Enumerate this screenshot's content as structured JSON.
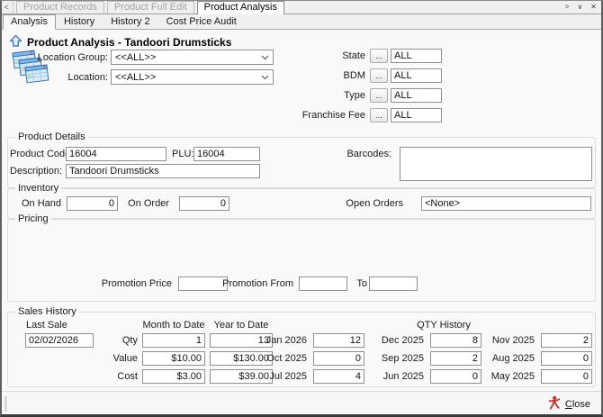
{
  "chrome": {
    "scroll_left_glyph": "<",
    "scroll_right_glyph": ">",
    "tab_list_glyph": "∨",
    "close_glyph": "✕",
    "tabs": [
      {
        "label": "Product Records"
      },
      {
        "label": "Product Full Edit"
      },
      {
        "label": "Product Analysis"
      }
    ]
  },
  "sub_tabs": [
    "Analysis",
    "History",
    "History 2",
    "Cost Price Audit"
  ],
  "page": {
    "title": "Product Analysis - Tandoori Drumsticks"
  },
  "filters": {
    "location_group_label": "Location Group:",
    "location_group_value": "<<ALL>>",
    "location_label": "Location:",
    "location_value": "<<ALL>>",
    "browse_glyph": "...",
    "rows": [
      {
        "label": "State",
        "value": "ALL"
      },
      {
        "label": "BDM",
        "value": "ALL"
      },
      {
        "label": "Type",
        "value": "ALL"
      },
      {
        "label": "Franchise Fee",
        "value": "ALL"
      }
    ]
  },
  "product_details": {
    "legend": "Product Details",
    "product_code_label": "Product Code:",
    "product_code": "16004",
    "plu_label": "PLU:",
    "plu": "16004",
    "description_label": "Description:",
    "description": "Tandoori Drumsticks",
    "barcodes_label": "Barcodes:",
    "barcodes": ""
  },
  "inventory": {
    "legend": "Inventory",
    "on_hand_label": "On Hand",
    "on_hand": "0",
    "on_order_label": "On Order",
    "on_order": "0",
    "open_orders_label": "Open Orders",
    "open_orders": "<None>"
  },
  "pricing": {
    "legend": "Pricing",
    "promotion_price_label": "Promotion Price",
    "promotion_price": "",
    "promotion_from_label": "Promotion From",
    "promotion_from": "",
    "to_label": "To",
    "promotion_to": ""
  },
  "sales_history": {
    "legend": "Sales History",
    "last_sale_label": "Last Sale",
    "last_sale": "02/02/2026",
    "month_to_date_label": "Month to Date",
    "year_to_date_label": "Year to Date",
    "qty_history_label": "QTY History",
    "rows": [
      {
        "label": "Qty",
        "mtd": "1",
        "ytd": "13"
      },
      {
        "label": "Value",
        "mtd": "$10.00",
        "ytd": "$130.00"
      },
      {
        "label": "Cost",
        "mtd": "$3.00",
        "ytd": "$39.00"
      }
    ],
    "months": [
      [
        {
          "label": "Jan 2026",
          "value": "12"
        },
        {
          "label": "Dec 2025",
          "value": "8"
        },
        {
          "label": "Nov 2025",
          "value": "2"
        }
      ],
      [
        {
          "label": "Oct 2025",
          "value": "0"
        },
        {
          "label": "Sep 2025",
          "value": "2"
        },
        {
          "label": "Aug 2025",
          "value": "0"
        }
      ],
      [
        {
          "label": "Jul 2025",
          "value": "4"
        },
        {
          "label": "Jun 2025",
          "value": "0"
        },
        {
          "label": "May 2025",
          "value": "0"
        }
      ]
    ]
  },
  "footer": {
    "close_label": "Close"
  },
  "colors": {
    "accent_blue": "#3f76bb",
    "close_red": "#c2362c"
  }
}
